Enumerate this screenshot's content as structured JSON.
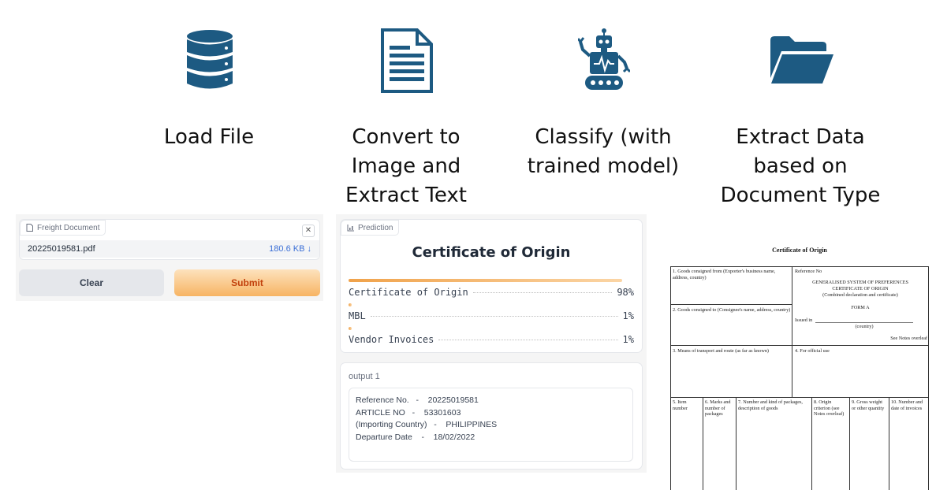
{
  "pipeline": {
    "steps": [
      {
        "label": "Load File",
        "icon": "database-icon"
      },
      {
        "label": "Convert to\nImage and\nExtract Text",
        "icon": "document-icon"
      },
      {
        "label": "Classify (with\ntrained model)",
        "icon": "robot-icon"
      },
      {
        "label": "Extract Data\nbased on\nDocument Type",
        "icon": "folder-icon"
      }
    ],
    "icon_color": "#1d5a82"
  },
  "upload": {
    "tag_label": "Freight Document",
    "file_name": "20225019581.pdf",
    "file_size": "180.6 KB ↓",
    "clear_label": "Clear",
    "submit_label": "Submit"
  },
  "prediction": {
    "tag_label": "Prediction",
    "title": "Certificate of Origin",
    "confidences": [
      {
        "label": "Certificate of Origin",
        "percent": "98%",
        "value": 0.98
      },
      {
        "label": "MBL",
        "percent": "1%",
        "value": 0.01
      },
      {
        "label": "Vendor Invoices",
        "percent": "1%",
        "value": 0.01
      }
    ]
  },
  "output": {
    "label": "output 1",
    "lines": [
      "Reference No.   -    20225019581",
      "ARTICLE NO   -    53301603",
      "(Importing Country)   -    PHILIPPINES",
      "Departure Date    -    18/02/2022"
    ]
  },
  "certificate": {
    "title": "Certificate of Origin",
    "box1": "1.  Goods consigned from (Exporter's business name, address, country)",
    "ref_no": "Reference No",
    "gsp": "GENERALISED SYSTEM OF PREFERENCES",
    "cert_of_origin": "CERTIFICATE OF ORIGIN",
    "combined": "(Combined declaration and certificate)",
    "form_a": "FORM A",
    "issued_in": "Issued in",
    "country": "(country)",
    "see_notes": "See Notes overleaf",
    "box2": "2.  Goods consigned to (Consignee's name, address, country)",
    "box3": "3.  Means of transport and route (as far as known)",
    "box4": "4.  For official use",
    "col5": "5.  Item number",
    "col6": "6.  Marks and number of packages",
    "col7": "7.  Number and kind of packages, description of goods",
    "col8": "8.  Origin criterion (see Notes overleaf)",
    "col9": "9.  Gross weight or other quantity",
    "col10": "10. Number and date of invoices"
  }
}
